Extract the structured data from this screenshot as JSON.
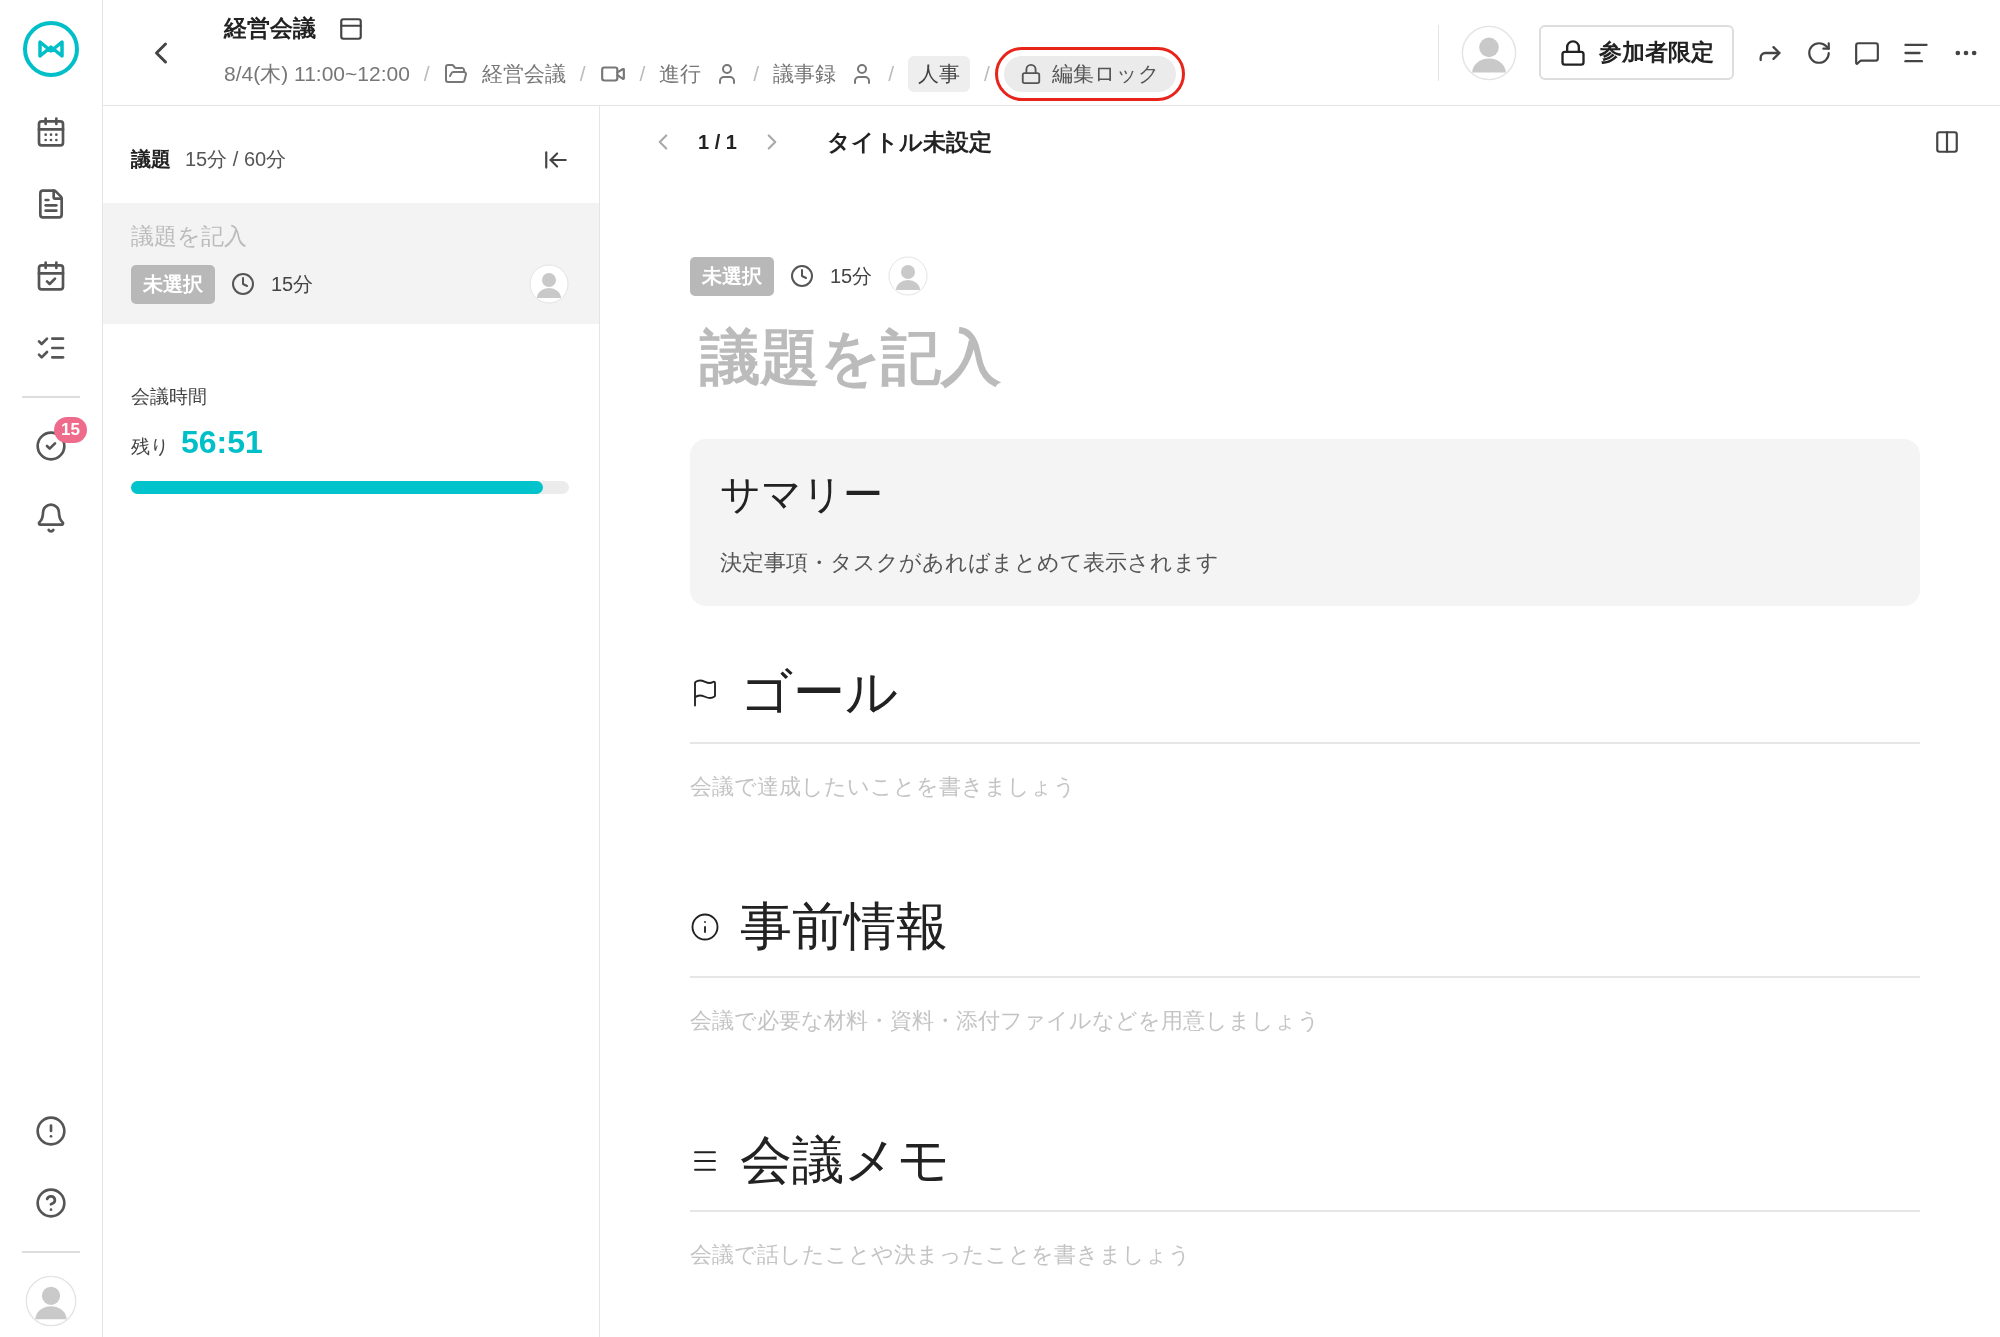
{
  "header": {
    "title": "経営会議",
    "date": "8/4(木) 11:00~12:00",
    "breadcrumbs": [
      {
        "kind": "folder",
        "label": "経営会議"
      },
      {
        "kind": "video"
      },
      {
        "kind": "person",
        "label": "進行"
      },
      {
        "kind": "person",
        "label": "議事録"
      },
      {
        "kind": "tag",
        "label": "人事"
      },
      {
        "kind": "lock",
        "label": "編集ロック",
        "highlighted": true
      }
    ],
    "access_button": "参加者限定",
    "separator": "/"
  },
  "rail": {
    "badge": "15"
  },
  "agenda_panel": {
    "heading": "議題",
    "duration": "15分 / 60分",
    "items": [
      {
        "title": "議題を記入",
        "status": "未選択",
        "time": "15分",
        "selected": true
      }
    ],
    "meeting_time_label": "会議時間",
    "remaining_label": "残り",
    "remaining": "56:51",
    "level": 0.94
  },
  "page": {
    "pager": "1 / 1",
    "title": "タイトル未設定",
    "status": "未選択",
    "time": "15分",
    "heading": "議題を記入",
    "summary": {
      "title": "サマリー",
      "text": "決定事項・タスクがあればまとめて表示されます"
    },
    "sections": [
      {
        "kind": "goal",
        "title": "ゴール",
        "placeholder": "会議で達成したいことを書きましょう"
      },
      {
        "kind": "info",
        "title": "事前情報",
        "placeholder": "会議で必要な材料・資料・添付ファイルなどを用意しましょう"
      },
      {
        "kind": "memo",
        "title": "会議メモ",
        "placeholder": "会議で話したことや決まったことを書きましょう"
      }
    ]
  }
}
